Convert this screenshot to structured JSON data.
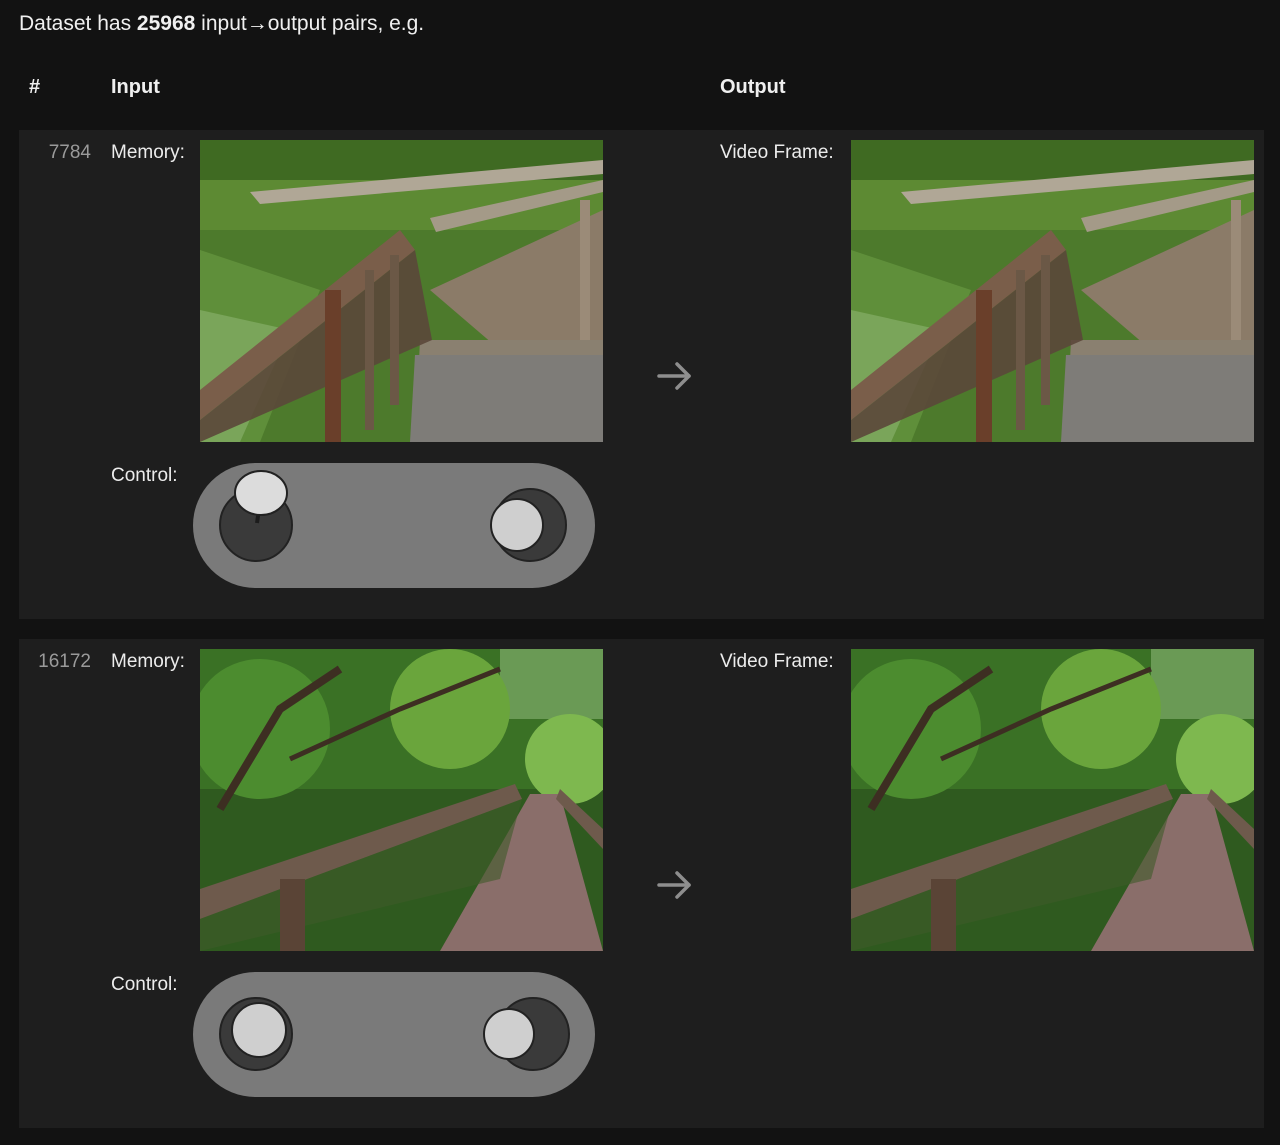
{
  "summary": {
    "prefix": "Dataset has",
    "count": "25968",
    "suffix": "input→output pairs, e.g."
  },
  "headers": {
    "index": "#",
    "input": "Input",
    "output": "Output"
  },
  "labels": {
    "memory": "Memory:",
    "control": "Control:",
    "video_frame": "Video Frame:"
  },
  "arrow_icon": "right-arrow-icon",
  "examples": [
    {
      "id": "7784",
      "scene": "boardwalk-corner"
    },
    {
      "id": "16172",
      "scene": "forest-boardwalk"
    }
  ],
  "colors": {
    "background": "#121212",
    "card": "#1e1e1e",
    "pill": "#7a7a7a",
    "stick_dark": "#3c3c3c",
    "stick_light": "#d0d0d0"
  }
}
